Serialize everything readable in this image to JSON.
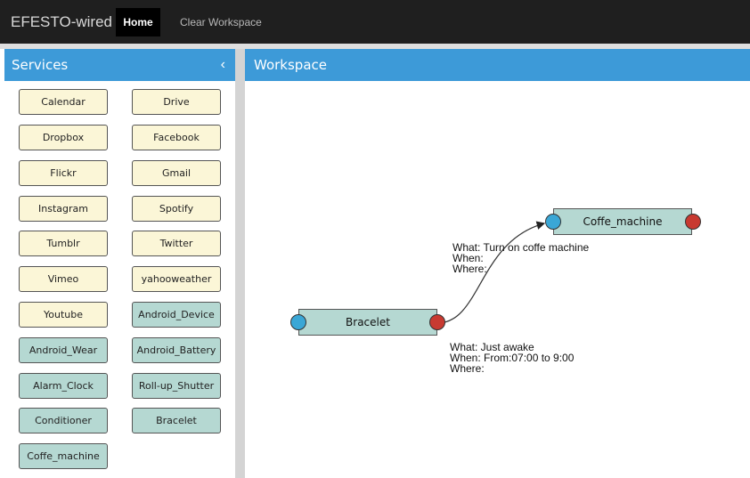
{
  "app": {
    "brand": "EFESTO-wired"
  },
  "nav": {
    "home": "Home",
    "clear": "Clear Workspace"
  },
  "sidebar": {
    "title": "Services",
    "collapse_glyph": "‹",
    "services": [
      "Calendar",
      "Drive",
      "Dropbox",
      "Facebook",
      "Flickr",
      "Gmail",
      "Instagram",
      "Spotify",
      "Tumblr",
      "Twitter",
      "Vimeo",
      "yahooweather",
      "Youtube",
      "Android_Device",
      "Android_Wear",
      "Android_Battery",
      "Alarm_Clock",
      "Roll-up_Shutter",
      "Conditioner",
      "Bracelet",
      "Coffe_machine"
    ]
  },
  "workspace": {
    "title": "Workspace",
    "nodes": {
      "trigger": "Bracelet",
      "action": "Coffe_machine"
    },
    "action_annotation": {
      "what": "What: Turn on coffe machine",
      "when": "When:",
      "where": "Where:"
    },
    "trigger_annotation": {
      "what": "What: Just awake",
      "when": "When: From:07:00 to 9:00",
      "where": "Where:"
    }
  },
  "colors": {
    "topbar": "#1f1f1f",
    "accent": "#3d9ad8",
    "cloud_service": "#fbf6d7",
    "device_service": "#b5d8d2",
    "port_in": "#3aa7d6",
    "port_out": "#c83a31"
  },
  "icons": {
    "collapse": "chevron-left-icon"
  }
}
